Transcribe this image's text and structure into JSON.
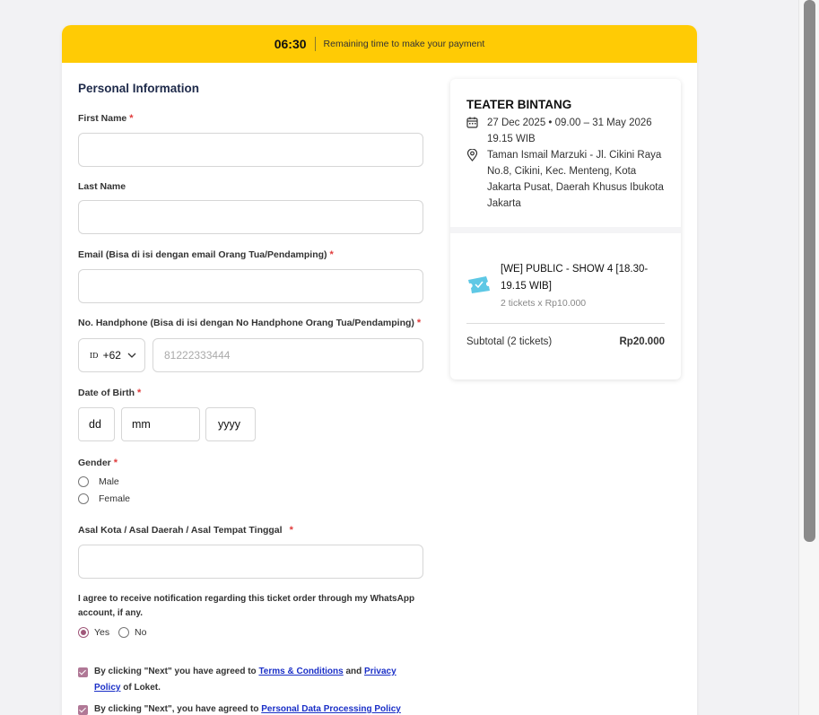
{
  "timer": {
    "time": "06:30",
    "message": "Remaining time to make your payment"
  },
  "form": {
    "section_title": "Personal Information",
    "first_name_label": "First Name",
    "last_name_label": "Last Name",
    "email_label": "Email (Bisa di isi dengan email Orang Tua/Pendamping)",
    "phone_label": "No. Handphone (Bisa di isi dengan No Handphone Orang Tua/Pendamping)",
    "phone_country_code": "ID",
    "phone_dial_code": "+62",
    "phone_placeholder": "81222333444",
    "dob_label": "Date of Birth",
    "dob_day": "dd",
    "dob_month": "mm",
    "dob_year": "yyyy",
    "gender_label": "Gender",
    "gender_options": [
      "Male",
      "Female"
    ],
    "city_label": "Asal Kota / Asal Daerah / Asal Tempat Tinggal",
    "required_mark": "*",
    "whatsapp_agree": "I agree to receive notification regarding this ticket order through my WhatsApp account, if any.",
    "whatsapp_options": [
      "Yes",
      "No"
    ],
    "whatsapp_selected": "Yes",
    "terms_prefix": "By clicking \"Next\" you have agreed to",
    "terms_link": "Terms & Conditions",
    "terms_and": "and",
    "privacy_link": "Privacy Policy",
    "terms_suffix": "of Loket.",
    "data_policy_prefix": "By clicking \"Next\", you have agreed to",
    "data_policy_link": "Personal Data Processing Policy"
  },
  "event": {
    "title": "TEATER BINTANG",
    "date": "27 Dec 2025 • 09.00 – 31 May 2026 19.15 WIB",
    "location": "Taman Ismail Marzuki - Jl. Cikini Raya No.8, Cikini, Kec. Menteng, Kota Jakarta Pusat, Daerah Khusus Ibukota Jakarta",
    "ticket_name": "[WE] PUBLIC - SHOW 4 [18.30-19.15 WIB]",
    "ticket_qty": "2 tickets x Rp10.000",
    "subtotal_label": "Subtotal (2 tickets)",
    "subtotal_value": "Rp20.000",
    "colors": {
      "accent": "#ffcb05",
      "ticket_icon": "#5ec8e5",
      "checkbox": "#b07896"
    }
  }
}
